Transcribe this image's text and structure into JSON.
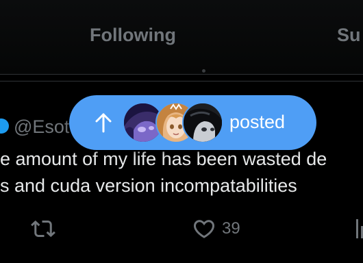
{
  "tabs": {
    "following": "Following",
    "subscribed": "Su"
  },
  "tweet": {
    "handle": "@Esot",
    "text_lines": [
      "e amount of my life has been wasted de",
      "s and cuda version incompatabilities"
    ],
    "like_count": "39"
  },
  "posted_pill": {
    "label": "posted",
    "avatars": [
      "avatar-purple-anime",
      "avatar-blonde-anime",
      "avatar-dark-anime"
    ]
  },
  "colors": {
    "pill_background": "#4f9ef5",
    "verified_blue": "#1d9bf0",
    "secondary_text": "#71767b",
    "primary_text": "#e7e9ea"
  },
  "icons": {
    "arrow": "arrow-up-icon",
    "retweet": "retweet-icon",
    "like": "heart-icon",
    "analytics": "analytics-icon",
    "verified": "verified-badge-icon"
  }
}
